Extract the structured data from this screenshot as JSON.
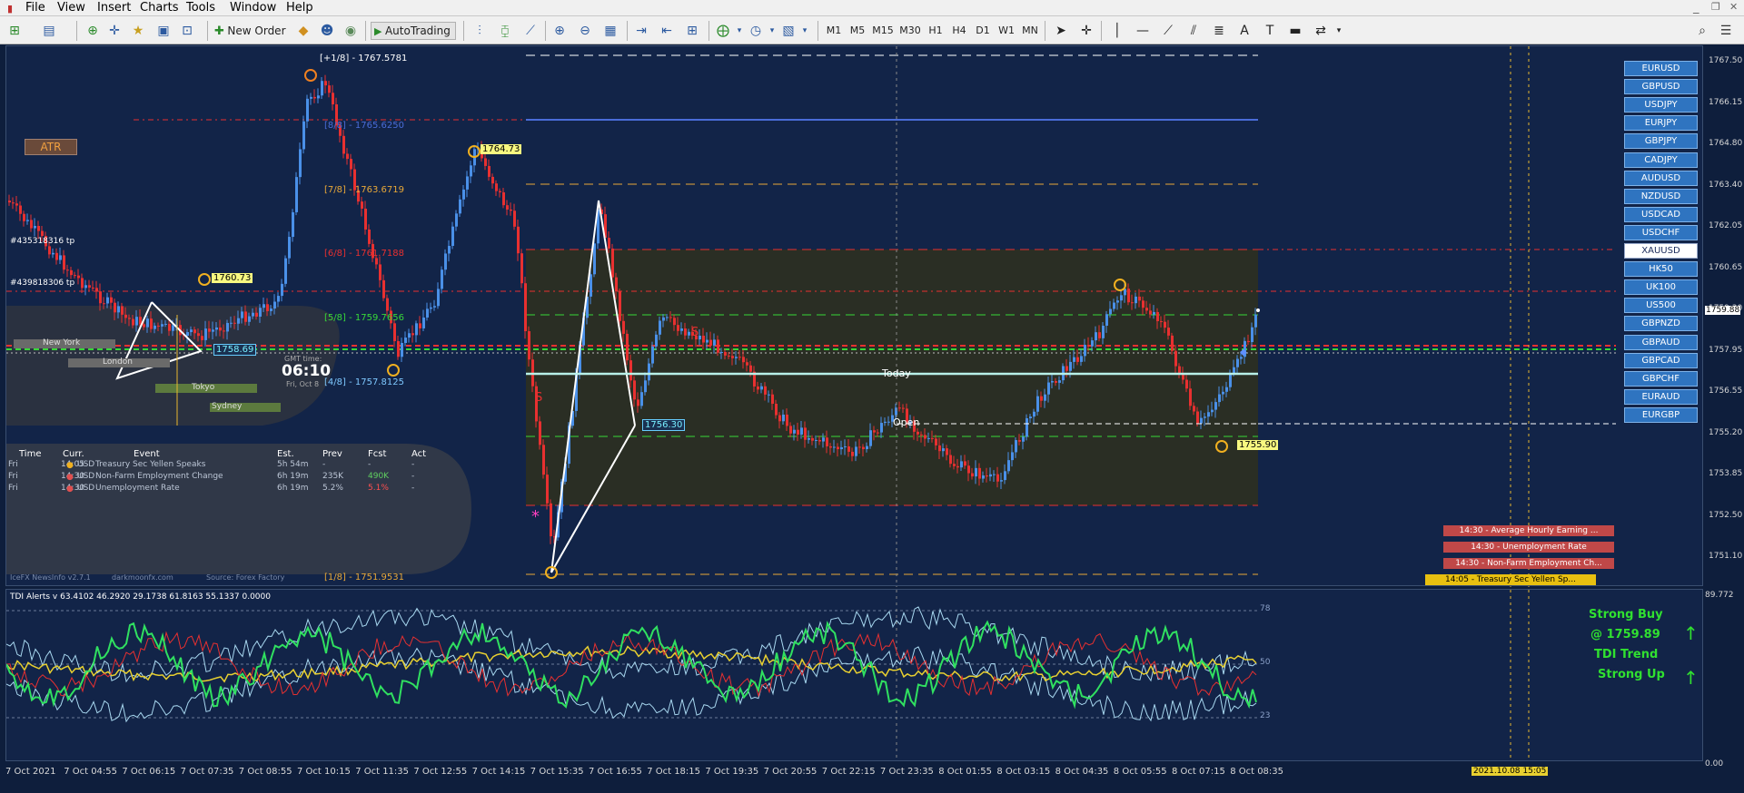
{
  "menu": [
    "File",
    "View",
    "Insert",
    "Charts",
    "Tools",
    "Window",
    "Help"
  ],
  "toolbar": {
    "new_order": "New Order",
    "autotrading": "AutoTrading",
    "timeframes": [
      "M1",
      "M5",
      "M15",
      "M30",
      "H1",
      "H4",
      "D1",
      "W1",
      "MN"
    ]
  },
  "chart": {
    "price_axis": [
      "1767.50",
      "1766.15",
      "1764.80",
      "1763.40",
      "1762.05",
      "1760.65",
      "1759.30",
      "1757.95",
      "1756.55",
      "1755.20",
      "1753.85",
      "1752.50",
      "1751.10"
    ],
    "current_price": "1759.88",
    "tdi_axis_top": "89.772",
    "tdi_axis_bottom": "0.00",
    "murrey": [
      {
        "label": "[+1/8] - 1767.5781",
        "color": "#ffffff"
      },
      {
        "label": "[8/8] - 1765.6250",
        "color": "#4a6cd8"
      },
      {
        "label": "[7/8] - 1763.6719",
        "color": "#e8a838"
      },
      {
        "label": "[6/8] - 1761.7188",
        "color": "#e83030"
      },
      {
        "label": "[5/8] - 1759.7656",
        "color": "#38d838"
      },
      {
        "label": "[4/8] - 1757.8125",
        "color": "#7ec8ff"
      },
      {
        "label": "[1/8] - 1751.9531",
        "color": "#e8a838"
      }
    ],
    "tp_labels": [
      "#435318316 tp",
      "#439818306 tp"
    ],
    "atr_label": "ATR",
    "price_tags": [
      "1764.73",
      "1760.73",
      "1758.69",
      "1756.30",
      "1755.90"
    ],
    "today_label": "Today",
    "open_label": "Open",
    "s_marker": "S",
    "pairs": [
      "EURUSD",
      "GBPUSD",
      "USDJPY",
      "EURJPY",
      "GBPJPY",
      "CADJPY",
      "AUDUSD",
      "NZDUSD",
      "USDCAD",
      "USDCHF",
      "XAUUSD",
      "HK50",
      "UK100",
      "US500",
      "GBPNZD",
      "GBPAUD",
      "GBPCAD",
      "GBPCHF",
      "EURAUD",
      "EURGBP"
    ],
    "selected_pair": "XAUUSD",
    "alerts": [
      "14:30 - Average Hourly Earning ...",
      "14:30 - Unemployment Rate",
      "14:30 - Non-Farm Employment Ch...",
      "14:05 - Treasury Sec Yellen Sp..."
    ],
    "sessions": [
      "New York",
      "London",
      "Tokyo",
      "Sydney"
    ],
    "gmt_label": "GMT time:",
    "gmt_time": "06:10",
    "gmt_date": "Fri, Oct 8",
    "news": {
      "headers": [
        "Time",
        "Curr.",
        "Event",
        "Est.",
        "Prev",
        "Fcst",
        "Act"
      ],
      "rows": [
        [
          "Fri",
          "14:05",
          "USD",
          "Treasury Sec Yellen Speaks",
          "5h 54m",
          "-",
          "-",
          "-"
        ],
        [
          "Fri",
          "14:30",
          "USD",
          "Non-Farm Employment Change",
          "6h 19m",
          "235K",
          "490K",
          "-"
        ],
        [
          "Fri",
          "14:30",
          "USD",
          "Unemployment Rate",
          "6h 19m",
          "5.2%",
          "5.1%",
          "-"
        ]
      ],
      "footer": [
        "IceFX NewsInfo v2.7.1",
        "darkmoonfx.com",
        "Source: Forex Factory"
      ]
    }
  },
  "tdi": {
    "title": "TDI Alerts v 63.4102 46.2920 29.1738 61.8163 55.1337 0.0000",
    "levels": [
      "78",
      "50",
      "23"
    ],
    "signal1": "Strong Buy",
    "signal2": "@ 1759.89",
    "signal3": "TDI Trend",
    "signal4": "Strong Up"
  },
  "time_axis": [
    "7 Oct 2021",
    "7 Oct 04:55",
    "7 Oct 06:15",
    "7 Oct 07:35",
    "7 Oct 08:55",
    "7 Oct 10:15",
    "7 Oct 11:35",
    "7 Oct 12:55",
    "7 Oct 14:15",
    "7 Oct 15:35",
    "7 Oct 16:55",
    "7 Oct 18:15",
    "7 Oct 19:35",
    "7 Oct 20:55",
    "7 Oct 22:15",
    "7 Oct 23:35",
    "8 Oct 01:55",
    "8 Oct 03:15",
    "8 Oct 04:35",
    "8 Oct 05:55",
    "8 Oct 07:15",
    "8 Oct 08:35"
  ],
  "time_marker": "2021.10.08 15:05"
}
